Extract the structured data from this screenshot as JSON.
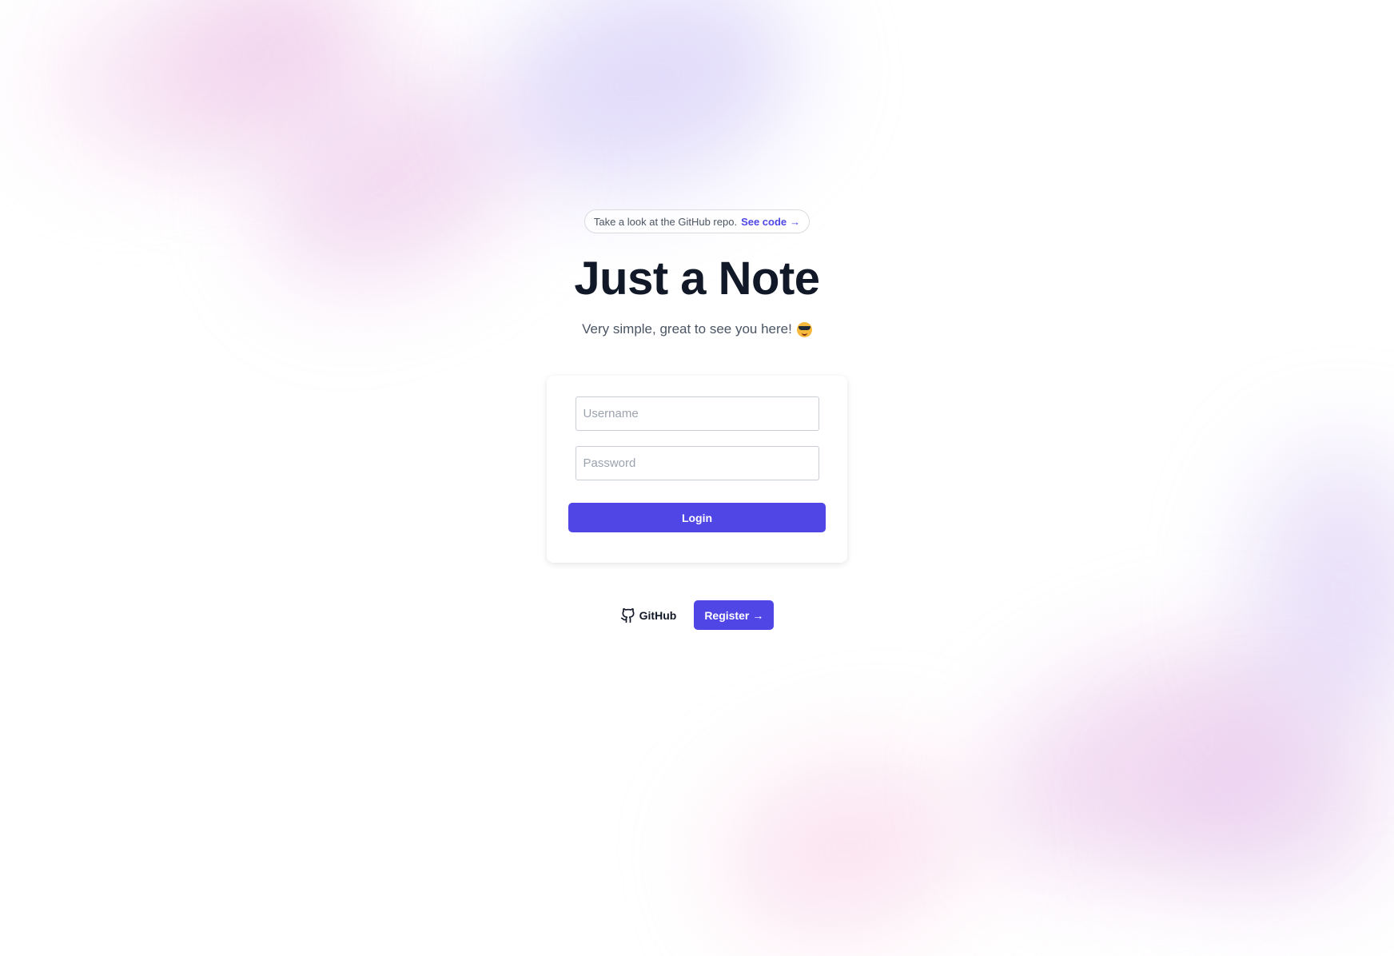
{
  "banner": {
    "text": "Take a look at the GitHub repo.",
    "link_label": "See code",
    "link_arrow": "→"
  },
  "header": {
    "title": "Just a Note",
    "subtitle": "Very simple, great to see you here!",
    "subtitle_emoji": "smiling-face-with-sunglasses-icon"
  },
  "login_form": {
    "username_placeholder": "Username",
    "username_value": "",
    "password_placeholder": "Password",
    "password_value": "",
    "login_label": "Login"
  },
  "footer": {
    "github_label": "GitHub",
    "github_icon": "github-icon",
    "register_label": "Register",
    "register_arrow": "→"
  },
  "colors": {
    "accent": "#4f46e5",
    "title": "#111827",
    "muted_text": "#4b5563",
    "background": "#ffffff"
  }
}
